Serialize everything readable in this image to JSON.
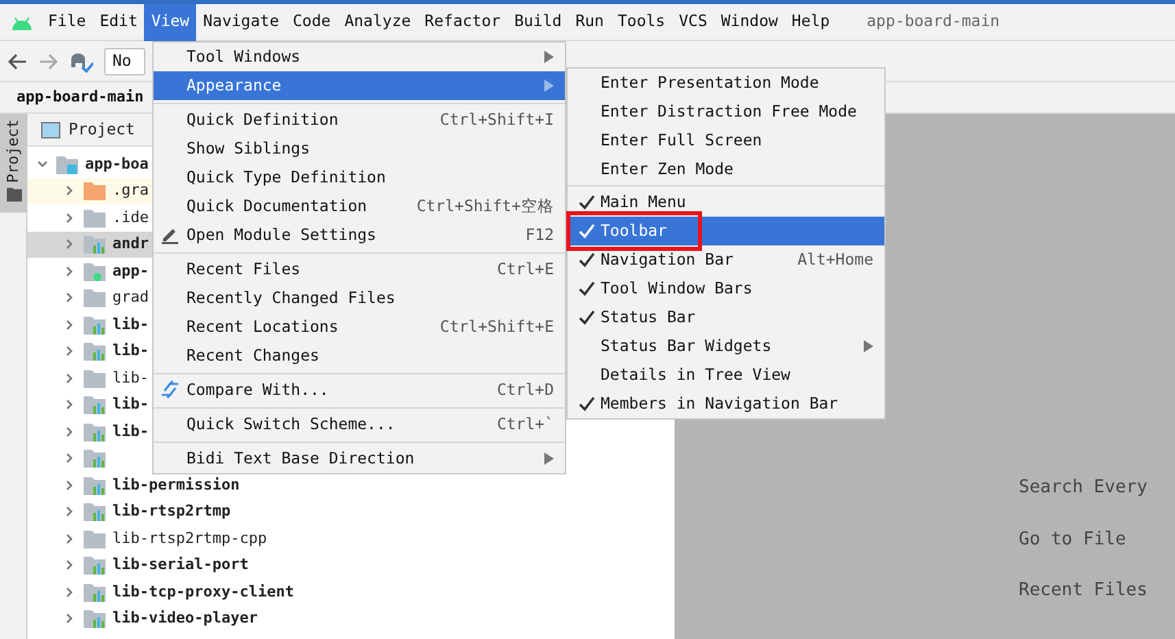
{
  "menu_bar": {
    "items": [
      {
        "label": "File",
        "selected": false
      },
      {
        "label": "Edit",
        "selected": false
      },
      {
        "label": "View",
        "selected": true
      },
      {
        "label": "Navigate",
        "selected": false
      },
      {
        "label": "Code",
        "selected": false
      },
      {
        "label": "Analyze",
        "selected": false
      },
      {
        "label": "Refactor",
        "selected": false
      },
      {
        "label": "Build",
        "selected": false
      },
      {
        "label": "Run",
        "selected": false
      },
      {
        "label": "Tools",
        "selected": false
      },
      {
        "label": "VCS",
        "selected": false
      },
      {
        "label": "Window",
        "selected": false
      },
      {
        "label": "Help",
        "selected": false
      }
    ],
    "project_title": "app-board-main"
  },
  "toolbar": {
    "run_config": "No"
  },
  "breadcrumb": "app-board-main",
  "tool_strip": {
    "tabs": [
      {
        "label": "Project",
        "selected": true
      }
    ]
  },
  "project_panel": {
    "title": "Project",
    "tree": [
      {
        "label": "app-boa",
        "kind": "root",
        "bold": true,
        "selected": false,
        "expanded": true,
        "children": [
          {
            "label": ".gra",
            "kind": "orange_folder",
            "bold": false,
            "selected": false,
            "expanded": false
          },
          {
            "label": ".ide",
            "kind": "folder",
            "bold": false,
            "selected": false,
            "expanded": false
          },
          {
            "label": "andr",
            "kind": "module",
            "bold": true,
            "selected": true,
            "expanded": false
          },
          {
            "label": "app-",
            "kind": "app_module",
            "bold": true,
            "selected": false,
            "expanded": false
          },
          {
            "label": "grad",
            "kind": "folder",
            "bold": false,
            "selected": false,
            "expanded": false
          },
          {
            "label": "lib-",
            "kind": "module",
            "bold": true,
            "selected": false,
            "expanded": false
          },
          {
            "label": "lib-",
            "kind": "module",
            "bold": true,
            "selected": false,
            "expanded": false
          },
          {
            "label": "lib-",
            "kind": "folder",
            "bold": false,
            "selected": false,
            "expanded": false
          },
          {
            "label": "lib-",
            "kind": "module",
            "bold": true,
            "selected": false,
            "expanded": false
          },
          {
            "label": "lib-",
            "kind": "module",
            "bold": true,
            "selected": false,
            "expanded": false
          },
          {
            "kind": "module",
            "selected": false,
            "expanded": false
          },
          {
            "label": "lib-permission",
            "kind": "module",
            "bold": true,
            "selected": false,
            "expanded": false
          },
          {
            "label": "lib-rtsp2rtmp",
            "kind": "module",
            "bold": true,
            "selected": false,
            "expanded": false
          },
          {
            "label": "lib-rtsp2rtmp-cpp",
            "kind": "folder",
            "bold": false,
            "selected": false,
            "expanded": false
          },
          {
            "label": "lib-serial-port",
            "kind": "module",
            "bold": true,
            "selected": false,
            "expanded": false
          },
          {
            "label": "lib-tcp-proxy-client",
            "kind": "module",
            "bold": true,
            "selected": false,
            "expanded": false
          },
          {
            "label": "lib-video-player",
            "kind": "module",
            "bold": true,
            "selected": false,
            "expanded": false
          }
        ]
      }
    ]
  },
  "editor": {
    "hints": [
      {
        "label": "Search Every"
      },
      {
        "label": "Go to File"
      },
      {
        "label": "Recent Files"
      }
    ]
  },
  "view_menu": {
    "items": [
      {
        "kind": "item",
        "label": "Tool Windows",
        "submenu": true,
        "selected": false
      },
      {
        "kind": "item",
        "label": "Appearance",
        "submenu": true,
        "selected": true
      },
      {
        "kind": "separator"
      },
      {
        "kind": "item",
        "label": "Quick Definition",
        "shortcut": "Ctrl+Shift+I",
        "selected": false
      },
      {
        "kind": "item",
        "label": "Show Siblings",
        "selected": false
      },
      {
        "kind": "item",
        "label": "Quick Type Definition",
        "selected": false
      },
      {
        "kind": "item",
        "label": "Quick Documentation",
        "shortcut": "Ctrl+Shift+空格",
        "selected": false
      },
      {
        "kind": "settings_item",
        "label": "Open Module Settings",
        "shortcut": "F12",
        "selected": false
      },
      {
        "kind": "separator"
      },
      {
        "kind": "item",
        "label": "Recent Files",
        "shortcut": "Ctrl+E",
        "selected": false
      },
      {
        "kind": "item",
        "label": "Recently Changed Files",
        "selected": false
      },
      {
        "kind": "item",
        "label": "Recent Locations",
        "shortcut": "Ctrl+Shift+E",
        "selected": false
      },
      {
        "kind": "item",
        "label": "Recent Changes",
        "selected": false
      },
      {
        "kind": "separator"
      },
      {
        "kind": "compare_item",
        "label": "Compare With...",
        "shortcut": "Ctrl+D",
        "selected": false
      },
      {
        "kind": "separator"
      },
      {
        "kind": "item",
        "label": "Quick Switch Scheme...",
        "shortcut": "Ctrl+`",
        "selected": false
      },
      {
        "kind": "separator"
      },
      {
        "kind": "item",
        "label": "Bidi Text Base Direction",
        "submenu": true,
        "selected": false
      }
    ]
  },
  "appearance_menu": {
    "items": [
      {
        "kind": "item",
        "label": "Enter Presentation Mode",
        "checked": false,
        "selected": false
      },
      {
        "kind": "item",
        "label": "Enter Distraction Free Mode",
        "checked": false,
        "selected": false
      },
      {
        "kind": "item",
        "label": "Enter Full Screen",
        "checked": false,
        "selected": false
      },
      {
        "kind": "item",
        "label": "Enter Zen Mode",
        "checked": false,
        "selected": false
      },
      {
        "kind": "separator"
      },
      {
        "kind": "item",
        "label": "Main Menu",
        "checked": true,
        "selected": false
      },
      {
        "kind": "item",
        "label": "Toolbar",
        "checked": true,
        "selected": true,
        "highlighted": true
      },
      {
        "kind": "item",
        "label": "Navigation Bar",
        "shortcut": "Alt+Home",
        "checked": true,
        "selected": false
      },
      {
        "kind": "item",
        "label": "Tool Window Bars",
        "checked": true,
        "selected": false
      },
      {
        "kind": "item",
        "label": "Status Bar",
        "checked": true,
        "selected": false
      },
      {
        "kind": "item",
        "label": "Status Bar Widgets",
        "submenu": true,
        "checked": false,
        "selected": false
      },
      {
        "kind": "item",
        "label": "Details in Tree View",
        "checked": false,
        "selected": false
      },
      {
        "kind": "item",
        "label": "Members in Navigation Bar",
        "checked": true,
        "selected": false
      }
    ]
  }
}
